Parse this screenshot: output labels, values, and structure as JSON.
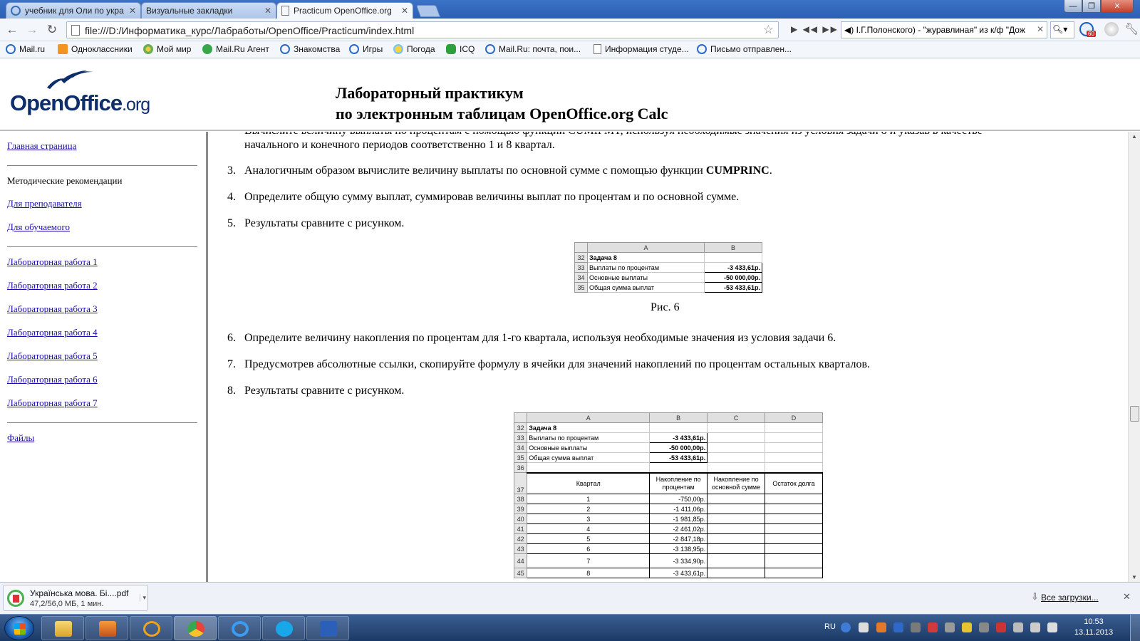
{
  "browser": {
    "tabs": [
      {
        "title": "учебник для Оли по укра"
      },
      {
        "title": "Визуальные закладки"
      },
      {
        "title": "Practicum OpenOffice.org"
      }
    ],
    "url": "file:///D:/Информатика_курс/Лабработы/OpenOffice/Practicum/index.html",
    "player_track": "I.Г.Полонского) - \"журавлиная\" из к/ф \"Дож",
    "mail_badge": "60",
    "icons": {
      "back": "back-arrow-icon",
      "forward": "forward-arrow-icon",
      "reload": "reload-icon",
      "star": "star-icon",
      "wrench": "wrench-icon"
    }
  },
  "bookmarks": [
    {
      "label": "Mail.ru",
      "icon": "at"
    },
    {
      "label": "Одноклассники",
      "icon": "ok"
    },
    {
      "label": "Мой мир",
      "icon": "mir"
    },
    {
      "label": "Mail.Ru Агент",
      "icon": "agent"
    },
    {
      "label": "Знакомства",
      "icon": "at"
    },
    {
      "label": "Игры",
      "icon": "at"
    },
    {
      "label": "Погода",
      "icon": "sun"
    },
    {
      "label": "ICQ",
      "icon": "icq"
    },
    {
      "label": "Mail.Ru: почта, пои...",
      "icon": "at"
    },
    {
      "label": "Информация студе...",
      "icon": "doc"
    },
    {
      "label": "Письмо отправлен...",
      "icon": "at"
    }
  ],
  "header": {
    "logo_brand": "OpenOffice",
    "logo_suffix": ".org",
    "title_line1": "Лабораторный практикум",
    "title_line2": "по электронным таблицам OpenOffice.org Calc"
  },
  "nav": {
    "home": "Главная страница",
    "methods_heading": "Методические рекомендации",
    "for_teacher": "Для преподавателя",
    "for_student": "Для обучаемого",
    "labs": [
      "Лабораторная работа 1",
      "Лабораторная работа 2",
      "Лабораторная работа 3",
      "Лабораторная работа 4",
      "Лабораторная работа 5",
      "Лабораторная работа 6",
      "Лабораторная работа 7"
    ],
    "files": "Файлы"
  },
  "content": {
    "clipped_line": "Вычислите величину выплаты по процентам с помощью функции CUMIPMT, используя необходимые значения из условия задачи 8 и указав в качестве",
    "item2_cont": "начального и конечного периодов соответственно 1 и 8 квартал.",
    "item3_num": "3.",
    "item3_pre": "Аналогичным образом вычислите величину выплаты по основной сумме с помощью функции ",
    "item3_bold": "CUMPRINC",
    "item3_post": ".",
    "item4_num": "4.",
    "item4": "Определите общую сумму выплат, суммировав величины выплат по процентам и по основной сумме.",
    "item5_num": "5.",
    "item5": "Результаты сравните с рисунком.",
    "fig6_caption": "Рис. 6",
    "item6_num": "6.",
    "item6": "Определите величину накопления по процентам для 1-го квартала, используя необходимые значения из условия задачи 6.",
    "item7_num": "7.",
    "item7": "Предусмотрев абсолютные ссылки, скопируйте формулу в ячейки для значений накоплений по процентам остальных кварталов.",
    "item8_num": "8.",
    "item8": "Результаты сравните с рисунком."
  },
  "figure6": {
    "col_headers": [
      "A",
      "B"
    ],
    "rows": [
      {
        "n": "32",
        "a": "Задача 8",
        "b": ""
      },
      {
        "n": "33",
        "a": "Выплаты по процентам",
        "b": "-3 433,61р."
      },
      {
        "n": "34",
        "a": "Основные выплаты",
        "b": "-50 000,00р."
      },
      {
        "n": "35",
        "a": "Общая сумма выплат",
        "b": "-53 433,61р."
      }
    ]
  },
  "figure7": {
    "col_headers": [
      "A",
      "B",
      "C",
      "D"
    ],
    "top_rows": [
      {
        "n": "32",
        "a": "Задача 8",
        "b": ""
      },
      {
        "n": "33",
        "a": "Выплаты по процентам",
        "b": "-3 433,61р."
      },
      {
        "n": "34",
        "a": "Основные выплаты",
        "b": "-50 000,00р."
      },
      {
        "n": "35",
        "a": "Общая сумма выплат",
        "b": "-53 433,61р."
      },
      {
        "n": "36",
        "a": "",
        "b": ""
      }
    ],
    "header_row": {
      "n": "37",
      "a": "Квартал",
      "b": "Накопление по процентам",
      "c": "Накопление по основной сумме",
      "d": "Остаток долга"
    },
    "data_rows": [
      {
        "n": "38",
        "q": "1",
        "v": "-750,00р."
      },
      {
        "n": "39",
        "q": "2",
        "v": "-1 411,06р."
      },
      {
        "n": "40",
        "q": "3",
        "v": "-1 981,85р."
      },
      {
        "n": "41",
        "q": "4",
        "v": "-2 461,02р."
      },
      {
        "n": "42",
        "q": "5",
        "v": "-2 847,18р."
      },
      {
        "n": "43",
        "q": "6",
        "v": "-3 138,95р."
      },
      {
        "n": "44",
        "q": "7",
        "v": "-3 334,90р."
      },
      {
        "n": "45",
        "q": "8",
        "v": "-3 433,61р."
      }
    ]
  },
  "downloads": {
    "file_name": "Українська мова. Бі....pdf",
    "status": "47,2/56,0 МБ, 1 мин.",
    "all_label": "Все загрузки..."
  },
  "taskbar": {
    "lang": "RU",
    "time": "10:53",
    "date": "13.11.2013"
  }
}
